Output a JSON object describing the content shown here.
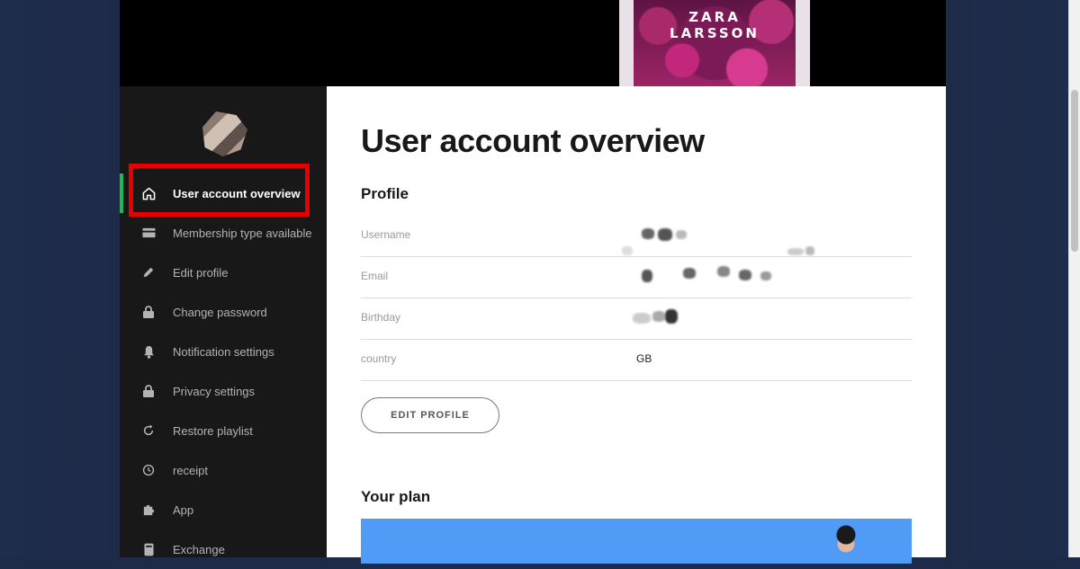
{
  "album": {
    "line1": "ZARA",
    "line2": "LARSSON"
  },
  "sidebar": {
    "items": [
      {
        "label": "User account overview",
        "icon": "home-icon",
        "active": true
      },
      {
        "label": "Membership type available",
        "icon": "card-icon"
      },
      {
        "label": "Edit profile",
        "icon": "pen-icon"
      },
      {
        "label": "Change password",
        "icon": "lock-icon"
      },
      {
        "label": "Notification settings",
        "icon": "bell-icon"
      },
      {
        "label": "Privacy settings",
        "icon": "lock-icon"
      },
      {
        "label": "Restore playlist",
        "icon": "restore-icon"
      },
      {
        "label": "receipt",
        "icon": "clock-icon"
      },
      {
        "label": "App",
        "icon": "puzzle-icon"
      },
      {
        "label": "Exchange",
        "icon": "device-icon"
      }
    ]
  },
  "main": {
    "title": "User account overview",
    "profile": {
      "heading": "Profile",
      "rows": [
        {
          "label": "Username",
          "value": ""
        },
        {
          "label": "Email",
          "value": ""
        },
        {
          "label": "Birthday",
          "value": ""
        },
        {
          "label": "country",
          "value": "GB"
        }
      ],
      "edit_button": "EDIT PROFILE"
    },
    "plan": {
      "heading": "Your plan"
    }
  },
  "colors": {
    "accent": "#1db954",
    "highlight": "#e80000",
    "plan_card": "#509bf5",
    "sidebar_bg": "#181818"
  }
}
